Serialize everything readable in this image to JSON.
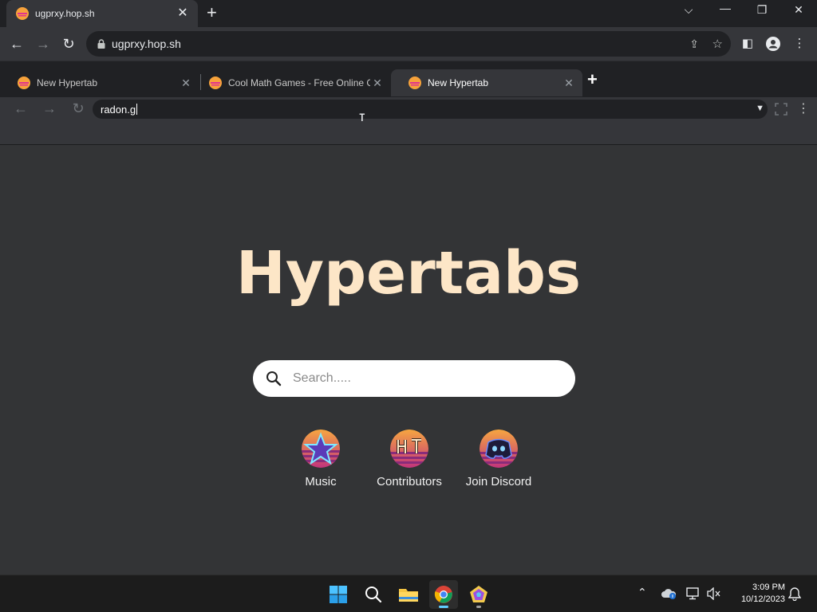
{
  "outer_browser": {
    "tab": {
      "title": "ugprxy.hop.sh"
    },
    "address": "ugprxy.hop.sh"
  },
  "inner_browser": {
    "tabs": [
      {
        "title": "New Hypertab"
      },
      {
        "title": "Cool Math Games - Free Online G"
      },
      {
        "title": "New Hypertab"
      }
    ],
    "address_value": "radon.g"
  },
  "page": {
    "title": "Hypertabs",
    "search": {
      "placeholder": "Search....."
    },
    "shortcuts": [
      {
        "label": "Music",
        "icon": "star-icon"
      },
      {
        "label": "Contributors",
        "icon": "ht-logo-icon"
      },
      {
        "label": "Join Discord",
        "icon": "discord-icon"
      }
    ]
  },
  "taskbar": {
    "apps": [
      "windows-start-icon",
      "search-icon",
      "file-explorer-icon",
      "chrome-icon",
      "app-icon"
    ],
    "clock": {
      "time": "3:09 PM",
      "date": "10/12/2023"
    }
  },
  "colors": {
    "accent_title": "#fde6c7",
    "page_bg": "#333436",
    "taskbar_indicator": "#60cdff"
  }
}
